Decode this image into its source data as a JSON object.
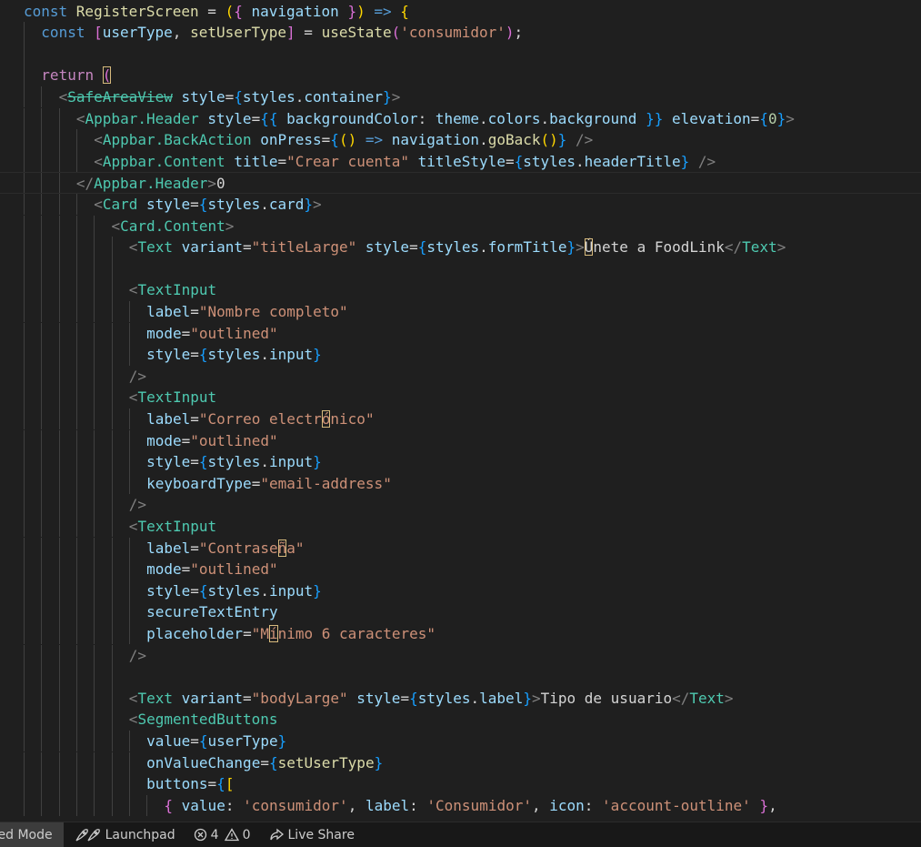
{
  "editor": {
    "lines": [
      {
        "indent": 0,
        "tokens": [
          [
            "kw",
            "const "
          ],
          [
            "fn",
            "RegisterScreen"
          ],
          [
            "plain",
            " = "
          ],
          [
            "b1",
            "("
          ],
          [
            "b2",
            "{"
          ],
          [
            "var",
            " navigation "
          ],
          [
            "b2",
            "}"
          ],
          [
            "b1",
            ")"
          ],
          [
            "kw",
            " => "
          ],
          [
            "b1",
            "{"
          ]
        ]
      },
      {
        "indent": 1,
        "tokens": [
          [
            "kw",
            "const "
          ],
          [
            "b2",
            "["
          ],
          [
            "var",
            "userType"
          ],
          [
            "plain",
            ", "
          ],
          [
            "fn",
            "setUserType"
          ],
          [
            "b2",
            "]"
          ],
          [
            "plain",
            " = "
          ],
          [
            "fn",
            "useState"
          ],
          [
            "b2",
            "("
          ],
          [
            "str",
            "'consumidor'"
          ],
          [
            "b2",
            ")"
          ],
          [
            "plain",
            ";"
          ]
        ]
      },
      {
        "indent": 0,
        "tokens": []
      },
      {
        "indent": 1,
        "tokens": [
          [
            "kwc",
            "return "
          ],
          [
            "b2",
            "("
          ]
        ],
        "hl_last": true
      },
      {
        "indent": 2,
        "tokens": [
          [
            "brk",
            "<"
          ],
          [
            "tag",
            "SafeAreaView",
            "strike"
          ],
          [
            "attr",
            " style"
          ],
          [
            "plain",
            "="
          ],
          [
            "b3",
            "{"
          ],
          [
            "var",
            "styles"
          ],
          [
            "plain",
            "."
          ],
          [
            "var",
            "container"
          ],
          [
            "b3",
            "}"
          ],
          [
            "brk",
            ">"
          ]
        ]
      },
      {
        "indent": 3,
        "tokens": [
          [
            "brk",
            "<"
          ],
          [
            "tag",
            "Appbar.Header"
          ],
          [
            "attr",
            " style"
          ],
          [
            "plain",
            "="
          ],
          [
            "b3",
            "{{"
          ],
          [
            "var",
            " backgroundColor"
          ],
          [
            "plain",
            ": "
          ],
          [
            "var",
            "theme"
          ],
          [
            "plain",
            "."
          ],
          [
            "var",
            "colors"
          ],
          [
            "plain",
            "."
          ],
          [
            "var",
            "background"
          ],
          [
            "b3",
            " }}"
          ],
          [
            "attr",
            " elevation"
          ],
          [
            "plain",
            "="
          ],
          [
            "b3",
            "{"
          ],
          [
            "num",
            "0"
          ],
          [
            "b3",
            "}"
          ],
          [
            "brk",
            ">"
          ]
        ]
      },
      {
        "indent": 4,
        "tokens": [
          [
            "brk",
            "<"
          ],
          [
            "tag",
            "Appbar.BackAction"
          ],
          [
            "attr",
            " onPress"
          ],
          [
            "plain",
            "="
          ],
          [
            "b3",
            "{"
          ],
          [
            "b1",
            "()"
          ],
          [
            "kw",
            " => "
          ],
          [
            "var",
            "navigation"
          ],
          [
            "plain",
            "."
          ],
          [
            "fn",
            "goBack"
          ],
          [
            "b1",
            "()"
          ],
          [
            "b3",
            "}"
          ],
          [
            "brk",
            " />"
          ]
        ]
      },
      {
        "indent": 4,
        "tokens": [
          [
            "brk",
            "<"
          ],
          [
            "tag",
            "Appbar.Content"
          ],
          [
            "attr",
            " title"
          ],
          [
            "plain",
            "="
          ],
          [
            "str",
            "\"Crear cuenta\""
          ],
          [
            "attr",
            " titleStyle"
          ],
          [
            "plain",
            "="
          ],
          [
            "b3",
            "{"
          ],
          [
            "var",
            "styles"
          ],
          [
            "plain",
            "."
          ],
          [
            "var",
            "headerTitle"
          ],
          [
            "b3",
            "}"
          ],
          [
            "brk",
            " />"
          ]
        ]
      },
      {
        "indent": 3,
        "tokens": [
          [
            "brk",
            "</"
          ],
          [
            "tag",
            "Appbar.Header"
          ],
          [
            "brk",
            ">"
          ],
          [
            "plain",
            "0"
          ]
        ],
        "current": true
      },
      {
        "indent": 4,
        "tokens": [
          [
            "brk",
            "<"
          ],
          [
            "tag",
            "Card"
          ],
          [
            "attr",
            " style"
          ],
          [
            "plain",
            "="
          ],
          [
            "b3",
            "{"
          ],
          [
            "var",
            "styles"
          ],
          [
            "plain",
            "."
          ],
          [
            "var",
            "card"
          ],
          [
            "b3",
            "}"
          ],
          [
            "brk",
            ">"
          ]
        ]
      },
      {
        "indent": 5,
        "tokens": [
          [
            "brk",
            "<"
          ],
          [
            "tag",
            "Card.Content"
          ],
          [
            "brk",
            ">"
          ]
        ]
      },
      {
        "indent": 6,
        "tokens": [
          [
            "brk",
            "<"
          ],
          [
            "tag",
            "Text"
          ],
          [
            "attr",
            " variant"
          ],
          [
            "plain",
            "="
          ],
          [
            "str",
            "\"titleLarge\""
          ],
          [
            "attr",
            " style"
          ],
          [
            "plain",
            "="
          ],
          [
            "b3",
            "{"
          ],
          [
            "var",
            "styles"
          ],
          [
            "plain",
            "."
          ],
          [
            "var",
            "formTitle"
          ],
          [
            "b3",
            "}"
          ],
          [
            "brk",
            ">"
          ],
          [
            "plain",
            "Ú",
            "hl"
          ],
          [
            "plain",
            "nete a FoodLink"
          ],
          [
            "brk",
            "</"
          ],
          [
            "tag",
            "Text"
          ],
          [
            "brk",
            ">"
          ]
        ]
      },
      {
        "indent": 0,
        "tokens": []
      },
      {
        "indent": 6,
        "tokens": [
          [
            "brk",
            "<"
          ],
          [
            "tag",
            "TextInput"
          ]
        ]
      },
      {
        "indent": 7,
        "tokens": [
          [
            "attr",
            "label"
          ],
          [
            "plain",
            "="
          ],
          [
            "str",
            "\"Nombre completo\""
          ]
        ]
      },
      {
        "indent": 7,
        "tokens": [
          [
            "attr",
            "mode"
          ],
          [
            "plain",
            "="
          ],
          [
            "str",
            "\"outlined\""
          ]
        ]
      },
      {
        "indent": 7,
        "tokens": [
          [
            "attr",
            "style"
          ],
          [
            "plain",
            "="
          ],
          [
            "b3",
            "{"
          ],
          [
            "var",
            "styles"
          ],
          [
            "plain",
            "."
          ],
          [
            "var",
            "input"
          ],
          [
            "b3",
            "}"
          ]
        ]
      },
      {
        "indent": 6,
        "tokens": [
          [
            "brk",
            "/>"
          ]
        ]
      },
      {
        "indent": 6,
        "tokens": [
          [
            "brk",
            "<"
          ],
          [
            "tag",
            "TextInput"
          ]
        ]
      },
      {
        "indent": 7,
        "tokens": [
          [
            "attr",
            "label"
          ],
          [
            "plain",
            "="
          ],
          [
            "str",
            "\"Correo electr"
          ],
          [
            "str",
            "ó",
            "hl"
          ],
          [
            "str",
            "nico\""
          ]
        ]
      },
      {
        "indent": 7,
        "tokens": [
          [
            "attr",
            "mode"
          ],
          [
            "plain",
            "="
          ],
          [
            "str",
            "\"outlined\""
          ]
        ]
      },
      {
        "indent": 7,
        "tokens": [
          [
            "attr",
            "style"
          ],
          [
            "plain",
            "="
          ],
          [
            "b3",
            "{"
          ],
          [
            "var",
            "styles"
          ],
          [
            "plain",
            "."
          ],
          [
            "var",
            "input"
          ],
          [
            "b3",
            "}"
          ]
        ]
      },
      {
        "indent": 7,
        "tokens": [
          [
            "attr",
            "keyboardType"
          ],
          [
            "plain",
            "="
          ],
          [
            "str",
            "\"email-address\""
          ]
        ]
      },
      {
        "indent": 6,
        "tokens": [
          [
            "brk",
            "/>"
          ]
        ]
      },
      {
        "indent": 6,
        "tokens": [
          [
            "brk",
            "<"
          ],
          [
            "tag",
            "TextInput"
          ]
        ]
      },
      {
        "indent": 7,
        "tokens": [
          [
            "attr",
            "label"
          ],
          [
            "plain",
            "="
          ],
          [
            "str",
            "\"Contrase"
          ],
          [
            "str",
            "ñ",
            "hl"
          ],
          [
            "str",
            "a\""
          ]
        ]
      },
      {
        "indent": 7,
        "tokens": [
          [
            "attr",
            "mode"
          ],
          [
            "plain",
            "="
          ],
          [
            "str",
            "\"outlined\""
          ]
        ]
      },
      {
        "indent": 7,
        "tokens": [
          [
            "attr",
            "style"
          ],
          [
            "plain",
            "="
          ],
          [
            "b3",
            "{"
          ],
          [
            "var",
            "styles"
          ],
          [
            "plain",
            "."
          ],
          [
            "var",
            "input"
          ],
          [
            "b3",
            "}"
          ]
        ]
      },
      {
        "indent": 7,
        "tokens": [
          [
            "attr",
            "secureTextEntry"
          ]
        ]
      },
      {
        "indent": 7,
        "tokens": [
          [
            "attr",
            "placeholder"
          ],
          [
            "plain",
            "="
          ],
          [
            "str",
            "\"M"
          ],
          [
            "str",
            "í",
            "hl"
          ],
          [
            "str",
            "nimo 6 caracteres\""
          ]
        ]
      },
      {
        "indent": 6,
        "tokens": [
          [
            "brk",
            "/>"
          ]
        ]
      },
      {
        "indent": 0,
        "tokens": []
      },
      {
        "indent": 6,
        "tokens": [
          [
            "brk",
            "<"
          ],
          [
            "tag",
            "Text"
          ],
          [
            "attr",
            " variant"
          ],
          [
            "plain",
            "="
          ],
          [
            "str",
            "\"bodyLarge\""
          ],
          [
            "attr",
            " style"
          ],
          [
            "plain",
            "="
          ],
          [
            "b3",
            "{"
          ],
          [
            "var",
            "styles"
          ],
          [
            "plain",
            "."
          ],
          [
            "var",
            "label"
          ],
          [
            "b3",
            "}"
          ],
          [
            "brk",
            ">"
          ],
          [
            "plain",
            "Tipo de usuario"
          ],
          [
            "brk",
            "</"
          ],
          [
            "tag",
            "Text"
          ],
          [
            "brk",
            ">"
          ]
        ]
      },
      {
        "indent": 6,
        "tokens": [
          [
            "brk",
            "<"
          ],
          [
            "tag",
            "SegmentedButtons"
          ]
        ]
      },
      {
        "indent": 7,
        "tokens": [
          [
            "attr",
            "value"
          ],
          [
            "plain",
            "="
          ],
          [
            "b3",
            "{"
          ],
          [
            "var",
            "userType"
          ],
          [
            "b3",
            "}"
          ]
        ]
      },
      {
        "indent": 7,
        "tokens": [
          [
            "attr",
            "onValueChange"
          ],
          [
            "plain",
            "="
          ],
          [
            "b3",
            "{"
          ],
          [
            "fn",
            "setUserType"
          ],
          [
            "b3",
            "}"
          ]
        ]
      },
      {
        "indent": 7,
        "tokens": [
          [
            "attr",
            "buttons"
          ],
          [
            "plain",
            "="
          ],
          [
            "b3",
            "{"
          ],
          [
            "b1",
            "["
          ]
        ]
      },
      {
        "indent": 8,
        "tokens": [
          [
            "b2",
            "{ "
          ],
          [
            "var",
            "value"
          ],
          [
            "plain",
            ": "
          ],
          [
            "str",
            "'consumidor'"
          ],
          [
            "plain",
            ", "
          ],
          [
            "var",
            "label"
          ],
          [
            "plain",
            ": "
          ],
          [
            "str",
            "'Consumidor'"
          ],
          [
            "plain",
            ", "
          ],
          [
            "var",
            "icon"
          ],
          [
            "plain",
            ": "
          ],
          [
            "str",
            "'account-outline'"
          ],
          [
            "b2",
            " }"
          ],
          [
            "plain",
            ","
          ]
        ]
      }
    ]
  },
  "statusbar": {
    "mode_label": "ted Mode",
    "launchpad_icon": "rocket-icon",
    "launchpad_label": "Launchpad",
    "errors_icon": "error-circle-icon",
    "errors_count": "4",
    "warnings_icon": "warning-triangle-icon",
    "warnings_count": "0",
    "liveshare_icon": "live-share-icon",
    "liveshare_label": "Live Share"
  }
}
